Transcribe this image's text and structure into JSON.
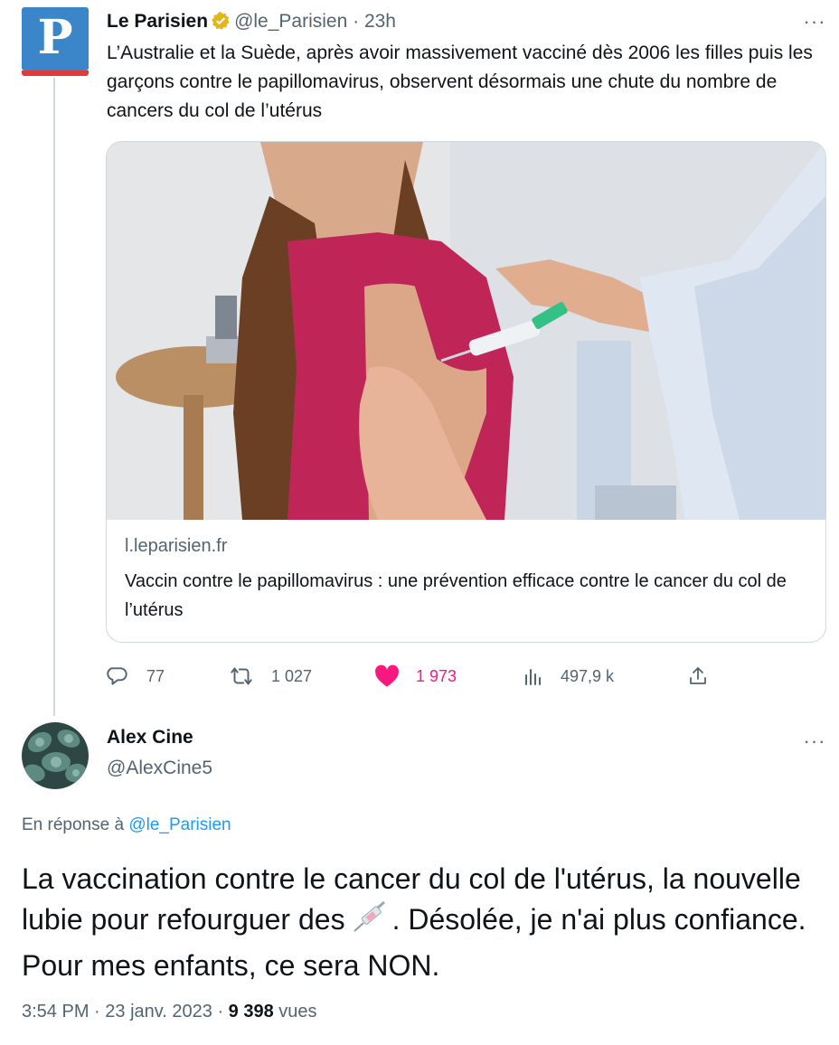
{
  "original_tweet": {
    "author_name": "Le Parisien",
    "handle": "@le_Parisien",
    "time": "23h",
    "avatar_letter": "P",
    "text": "L’Australie et la Suède, après avoir massivement vacciné dès 2006 les filles puis les garçons contre le papillomavirus, observent désormais une chute du nombre de cancers du col de l’utérus",
    "card": {
      "domain": "l.leparisien.fr",
      "title": "Vaccin contre le papillomavirus : une prévention efficace contre le cancer du col de l’utérus"
    },
    "actions": {
      "replies": "77",
      "retweets": "1 027",
      "likes": "1 973",
      "views": "497,9 k"
    }
  },
  "reply_tweet": {
    "author_name": "Alex Cine",
    "handle": "@AlexCine5",
    "replying_prefix": "En réponse à",
    "replying_to": "@le_Parisien",
    "text_before_emoji": "La vaccination contre le cancer du col de l'utérus, la nouvelle lubie pour refourguer des",
    "text_after_emoji": ". Désolée, je n'ai plus confiance. Pour mes enfants, ce sera NON.",
    "time": "3:54 PM",
    "date": "23 janv. 2023",
    "views": "9 398",
    "views_label": "vues"
  },
  "icons": {
    "verified": "verified-badge-icon",
    "more": "more-icon",
    "reply": "reply-icon",
    "retweet": "retweet-icon",
    "like": "like-icon",
    "views": "views-icon",
    "share": "share-icon",
    "emoji": "syringe-icon"
  },
  "colors": {
    "link": "#1d9bf0",
    "like": "#f91880",
    "muted": "#536471",
    "text": "#0f1419",
    "border": "#cfd9de",
    "verified_gold": "#e2b719",
    "brand_blue": "#3a86c8",
    "brand_red": "#e23a3a"
  }
}
